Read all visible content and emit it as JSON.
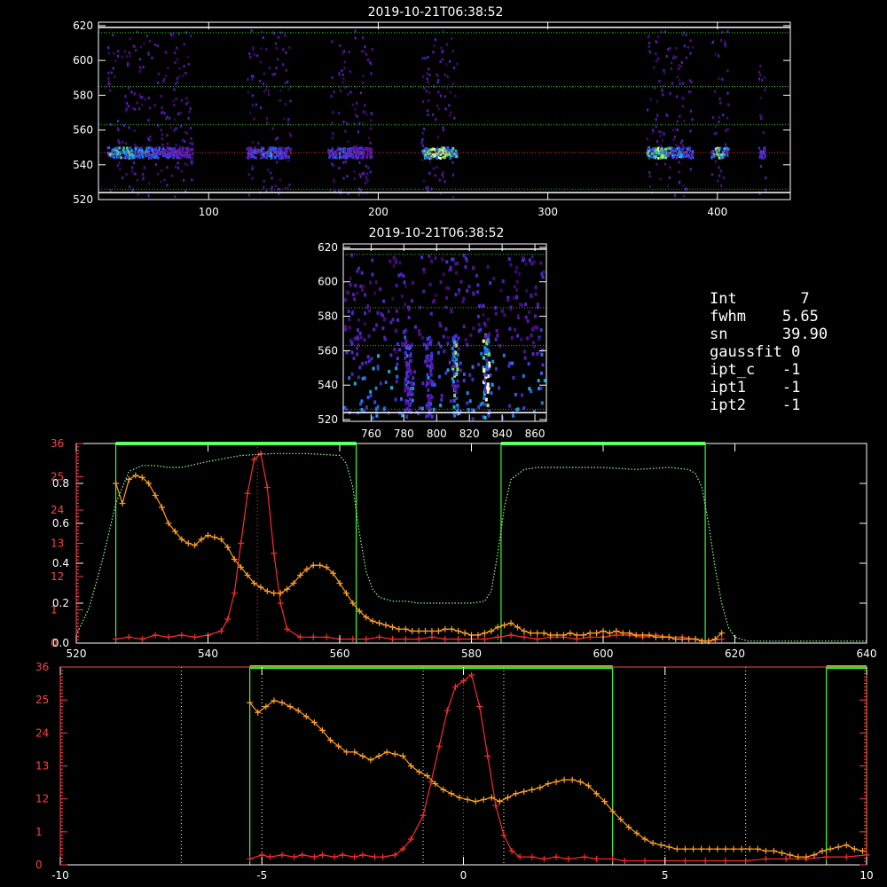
{
  "chart_data": [
    {
      "id": "top_image",
      "type": "heatmap",
      "title": "2019-10-21T06:38:52",
      "xlim": [
        35,
        443
      ],
      "ylim": [
        520,
        622
      ],
      "x_ticks": [
        100,
        200,
        300,
        400
      ],
      "y_ticks": [
        520,
        540,
        560,
        580,
        600,
        620
      ],
      "hlines": [
        {
          "y": 619,
          "color": "#ffffff",
          "style": "solid"
        },
        {
          "y": 616,
          "color": "#00cc00",
          "style": "dotted"
        },
        {
          "y": 585,
          "color": "#00cc00",
          "style": "dotted"
        },
        {
          "y": 563,
          "color": "#00cc00",
          "style": "dotted"
        },
        {
          "y": 547,
          "color": "#ff2020",
          "style": "dotted"
        },
        {
          "y": 526,
          "color": "#00cc00",
          "style": "dotted"
        },
        {
          "y": 524,
          "color": "#ffffff",
          "style": "solid"
        }
      ],
      "bands": [
        {
          "x0": 40,
          "x1": 90,
          "core_x": 43,
          "peak": 0.8
        },
        {
          "x0": 122,
          "x1": 148,
          "core_x": 135,
          "peak": 0.6
        },
        {
          "x0": 170,
          "x1": 196,
          "core_x": 178,
          "peak": 0.55
        },
        {
          "x0": 225,
          "x1": 246,
          "core_x": 235,
          "peak": 1.0
        },
        {
          "x0": 358,
          "x1": 385,
          "core_x": 366,
          "peak": 0.9
        },
        {
          "x0": 396,
          "x1": 406,
          "core_x": 400,
          "peak": 0.85
        },
        {
          "x0": 424,
          "x1": 428,
          "core_x": 426,
          "peak": 0.5
        }
      ]
    },
    {
      "id": "middle_image",
      "type": "heatmap",
      "title": "2019-10-21T06:38:52",
      "xlim": [
        743,
        867
      ],
      "ylim": [
        519,
        622
      ],
      "x_ticks": [
        760,
        780,
        800,
        820,
        840,
        860
      ],
      "y_ticks": [
        520,
        540,
        560,
        580,
        600,
        620
      ],
      "hlines": [
        {
          "y": 619,
          "color": "#ffffff",
          "style": "solid"
        },
        {
          "y": 616,
          "color": "#00cc00",
          "style": "dotted"
        },
        {
          "y": 585,
          "color": "#00cc00",
          "style": "dotted"
        },
        {
          "y": 563,
          "color": "#00cc00",
          "style": "dotted"
        },
        {
          "y": 526,
          "color": "#00cc00",
          "style": "dotted"
        },
        {
          "y": 524,
          "color": "#ffffff",
          "style": "solid"
        }
      ],
      "streaks": [
        {
          "x": 782,
          "peak": 0.5
        },
        {
          "x": 795,
          "peak": 0.45
        },
        {
          "x": 811,
          "peak": 0.8
        },
        {
          "x": 830,
          "peak": 1.0
        }
      ]
    },
    {
      "id": "profile_wavelength",
      "type": "line",
      "xlim": [
        520,
        640
      ],
      "x_ticks": [
        520,
        540,
        560,
        580,
        600,
        620,
        640
      ],
      "left_ticks_white": [
        "0.0",
        "0.2",
        "0.4",
        "0.6",
        "0.8"
      ],
      "left_ticks_red": [
        "0",
        "1",
        "12",
        "13",
        "24",
        "25",
        "36"
      ],
      "green_windows": [
        [
          526,
          562.5
        ],
        [
          584.5,
          615.5
        ]
      ],
      "series": [
        {
          "color": "#ff2a2a",
          "x": [
            526,
            528,
            530,
            532,
            534,
            536,
            538,
            540,
            542,
            543,
            544,
            545,
            546,
            547,
            548,
            549,
            550,
            551,
            552,
            554,
            556,
            558,
            560,
            562,
            564,
            566,
            568,
            570,
            572,
            574,
            576,
            578,
            580,
            582,
            584,
            586,
            588,
            590,
            592,
            594,
            596,
            598,
            600,
            602,
            604,
            606,
            608,
            610,
            612,
            614,
            616,
            618
          ],
          "y": [
            0.02,
            0.03,
            0.02,
            0.04,
            0.03,
            0.04,
            0.03,
            0.04,
            0.06,
            0.12,
            0.25,
            0.5,
            0.75,
            0.92,
            0.95,
            0.78,
            0.45,
            0.2,
            0.07,
            0.03,
            0.03,
            0.03,
            0.02,
            0.02,
            0.02,
            0.03,
            0.02,
            0.02,
            0.02,
            0.03,
            0.02,
            0.02,
            0.02,
            0.02,
            0.03,
            0.04,
            0.03,
            0.02,
            0.03,
            0.03,
            0.02,
            0.03,
            0.03,
            0.04,
            0.04,
            0.03,
            0.04,
            0.03,
            0.03,
            0.02,
            0.01,
            0.02
          ]
        },
        {
          "color": "#ffa020",
          "x": [
            526,
            527,
            528,
            529,
            530,
            531,
            532,
            533,
            534,
            535,
            536,
            537,
            538,
            539,
            540,
            541,
            542,
            543,
            544,
            545,
            546,
            547,
            548,
            549,
            550,
            551,
            552,
            553,
            554,
            555,
            556,
            557,
            558,
            559,
            560,
            561,
            562,
            563,
            564,
            565,
            566,
            567,
            568,
            569,
            570,
            571,
            572,
            573,
            574,
            575,
            576,
            577,
            578,
            579,
            580,
            581,
            582,
            583,
            584,
            585,
            586,
            587,
            588,
            589,
            590,
            591,
            592,
            593,
            594,
            595,
            596,
            597,
            598,
            599,
            600,
            601,
            602,
            603,
            604,
            605,
            606,
            607,
            608,
            609,
            610,
            611,
            612,
            613,
            614,
            615,
            616,
            617,
            618
          ],
          "y": [
            0.8,
            0.7,
            0.82,
            0.84,
            0.83,
            0.8,
            0.74,
            0.68,
            0.6,
            0.56,
            0.52,
            0.5,
            0.49,
            0.52,
            0.54,
            0.53,
            0.52,
            0.48,
            0.42,
            0.38,
            0.34,
            0.3,
            0.28,
            0.26,
            0.25,
            0.25,
            0.27,
            0.3,
            0.34,
            0.37,
            0.39,
            0.39,
            0.38,
            0.35,
            0.3,
            0.25,
            0.2,
            0.16,
            0.13,
            0.11,
            0.1,
            0.09,
            0.08,
            0.07,
            0.07,
            0.06,
            0.06,
            0.06,
            0.06,
            0.06,
            0.07,
            0.07,
            0.06,
            0.05,
            0.04,
            0.04,
            0.05,
            0.06,
            0.08,
            0.09,
            0.1,
            0.08,
            0.06,
            0.05,
            0.05,
            0.05,
            0.04,
            0.04,
            0.04,
            0.05,
            0.04,
            0.04,
            0.05,
            0.05,
            0.06,
            0.05,
            0.06,
            0.05,
            0.05,
            0.04,
            0.04,
            0.04,
            0.03,
            0.03,
            0.03,
            0.02,
            0.02,
            0.02,
            0.02,
            0.01,
            0.01,
            0.02,
            0.05
          ]
        },
        {
          "color": "#8cff8c",
          "style": "dotted",
          "x": [
            520,
            522,
            524,
            526,
            528,
            530,
            532,
            534,
            536,
            540,
            545,
            550,
            555,
            560,
            561,
            562,
            563,
            564,
            565,
            566,
            568,
            570,
            572,
            576,
            580,
            582,
            583,
            584,
            585,
            586,
            588,
            590,
            595,
            600,
            605,
            610,
            613,
            614,
            615,
            616,
            617,
            618,
            619,
            620,
            622,
            625,
            630,
            640
          ],
          "y": [
            0.04,
            0.18,
            0.42,
            0.7,
            0.86,
            0.89,
            0.89,
            0.88,
            0.88,
            0.91,
            0.94,
            0.95,
            0.95,
            0.94,
            0.9,
            0.78,
            0.55,
            0.36,
            0.27,
            0.23,
            0.21,
            0.21,
            0.2,
            0.2,
            0.2,
            0.21,
            0.26,
            0.45,
            0.68,
            0.82,
            0.87,
            0.88,
            0.88,
            0.88,
            0.87,
            0.88,
            0.87,
            0.85,
            0.78,
            0.6,
            0.38,
            0.2,
            0.08,
            0.03,
            0.01,
            0.01,
            0.01,
            0.01
          ]
        }
      ]
    },
    {
      "id": "profile_offset",
      "type": "line",
      "xlim": [
        -10,
        10
      ],
      "x_ticks": [
        -10,
        -5,
        0,
        5,
        10
      ],
      "left_ticks_red": [
        "0",
        "1",
        "12",
        "13",
        "24",
        "25",
        "36"
      ],
      "green_windows": [
        [
          -5.3,
          3.7
        ],
        [
          9,
          10
        ]
      ],
      "white_dotted_vlines": [
        -7,
        -5,
        -1,
        1,
        5,
        7
      ],
      "red_dotted_vlines": [
        0
      ],
      "series": [
        {
          "color": "#ff2a2a",
          "x": [
            -5.3,
            -5,
            -4.8,
            -4.5,
            -4.2,
            -4,
            -3.7,
            -3.5,
            -3.2,
            -3,
            -2.7,
            -2.5,
            -2.2,
            -2,
            -1.7,
            -1.5,
            -1.3,
            -1,
            -0.8,
            -0.6,
            -0.4,
            -0.2,
            0,
            0.2,
            0.4,
            0.6,
            0.8,
            1,
            1.2,
            1.4,
            1.7,
            2,
            2.3,
            2.6,
            3,
            3.3,
            3.7,
            4,
            4.5,
            5,
            5.5,
            6,
            6.5,
            7,
            7.5,
            8,
            8.5,
            9,
            9.5,
            10
          ],
          "y": [
            0.03,
            0.05,
            0.04,
            0.05,
            0.04,
            0.05,
            0.04,
            0.05,
            0.04,
            0.05,
            0.04,
            0.05,
            0.04,
            0.04,
            0.05,
            0.08,
            0.13,
            0.25,
            0.42,
            0.6,
            0.78,
            0.9,
            0.93,
            0.96,
            0.8,
            0.55,
            0.3,
            0.15,
            0.07,
            0.04,
            0.04,
            0.03,
            0.04,
            0.03,
            0.04,
            0.03,
            0.03,
            0.02,
            0.02,
            0.02,
            0.02,
            0.02,
            0.02,
            0.02,
            0.03,
            0.03,
            0.03,
            0.04,
            0.04,
            0.05
          ]
        },
        {
          "color": "#ffa020",
          "x": [
            -5.3,
            -5.1,
            -4.9,
            -4.7,
            -4.5,
            -4.3,
            -4.1,
            -3.9,
            -3.7,
            -3.5,
            -3.3,
            -3.1,
            -2.9,
            -2.7,
            -2.5,
            -2.3,
            -2.1,
            -1.9,
            -1.7,
            -1.5,
            -1.3,
            -1.1,
            -0.9,
            -0.7,
            -0.5,
            -0.3,
            -0.1,
            0.1,
            0.3,
            0.5,
            0.7,
            0.9,
            1.1,
            1.3,
            1.5,
            1.7,
            1.9,
            2.1,
            2.3,
            2.5,
            2.7,
            2.9,
            3.1,
            3.3,
            3.5,
            3.7,
            3.9,
            4.1,
            4.3,
            4.5,
            4.7,
            4.9,
            5.1,
            5.3,
            5.5,
            5.7,
            5.9,
            6.1,
            6.3,
            6.5,
            6.7,
            6.9,
            7.1,
            7.3,
            7.5,
            7.7,
            7.9,
            8.1,
            8.3,
            8.5,
            8.7,
            8.9,
            9.1,
            9.3,
            9.5,
            9.7,
            9.9
          ],
          "y": [
            0.82,
            0.77,
            0.8,
            0.83,
            0.82,
            0.8,
            0.78,
            0.75,
            0.72,
            0.68,
            0.63,
            0.6,
            0.57,
            0.57,
            0.55,
            0.53,
            0.55,
            0.57,
            0.56,
            0.55,
            0.5,
            0.47,
            0.45,
            0.41,
            0.38,
            0.36,
            0.34,
            0.33,
            0.32,
            0.33,
            0.34,
            0.32,
            0.34,
            0.36,
            0.37,
            0.38,
            0.39,
            0.41,
            0.42,
            0.43,
            0.43,
            0.42,
            0.4,
            0.36,
            0.32,
            0.27,
            0.23,
            0.19,
            0.16,
            0.13,
            0.11,
            0.1,
            0.09,
            0.08,
            0.08,
            0.08,
            0.08,
            0.08,
            0.08,
            0.08,
            0.08,
            0.08,
            0.08,
            0.08,
            0.07,
            0.07,
            0.06,
            0.05,
            0.04,
            0.04,
            0.05,
            0.07,
            0.08,
            0.09,
            0.1,
            0.08,
            0.07
          ]
        }
      ]
    }
  ],
  "info_panel": {
    "lines": [
      "Int       7",
      "fwhm    5.65",
      "sn      39.90",
      "gaussfit 0",
      "ipt_c   -1",
      "ipt1    -1",
      "ipt2    -1"
    ]
  },
  "colors": {
    "axis": "#ffffff",
    "red_axis": "#ff4040",
    "green_window": "#33ff33"
  }
}
